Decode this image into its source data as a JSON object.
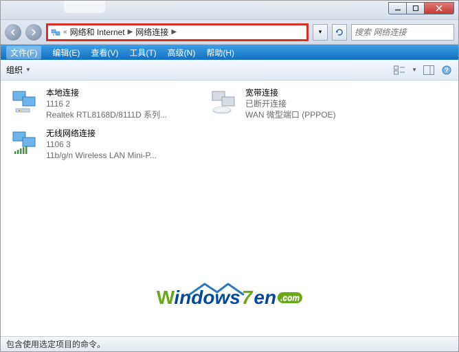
{
  "titlebar": {
    "min": "—",
    "max": "▢",
    "close": "×"
  },
  "breadcrumb": {
    "item1": "网络和 Internet",
    "item2": "网络连接"
  },
  "nav": {
    "drop": "▾",
    "refresh": "↻"
  },
  "search": {
    "placeholder": "搜索 网络连接"
  },
  "menubar": {
    "file": "文件(F)",
    "edit": "编辑(E)",
    "view": "查看(V)",
    "tools": "工具(T)",
    "advanced": "高级(N)",
    "help": "帮助(H)"
  },
  "toolbar": {
    "organize": "组织",
    "drop": "▼"
  },
  "items": [
    {
      "title": "本地连接",
      "line2": "1116  2",
      "line3": "Realtek RTL8168D/8111D 系列...",
      "icon": "lan"
    },
    {
      "title": "宽带连接",
      "line2": "已断开连接",
      "line3": "WAN 微型端口 (PPPOE)",
      "icon": "dialup-off"
    },
    {
      "title": "无线网络连接",
      "line2": "1106  3",
      "line3": "11b/g/n  Wireless LAN Mini-P...",
      "icon": "wifi"
    }
  ],
  "watermark": {
    "text1": "W",
    "text2": "indows",
    "seven": "7",
    "text3": "en",
    "com": ".com"
  },
  "statusbar": {
    "text": "包含使用选定项目的命令。"
  }
}
